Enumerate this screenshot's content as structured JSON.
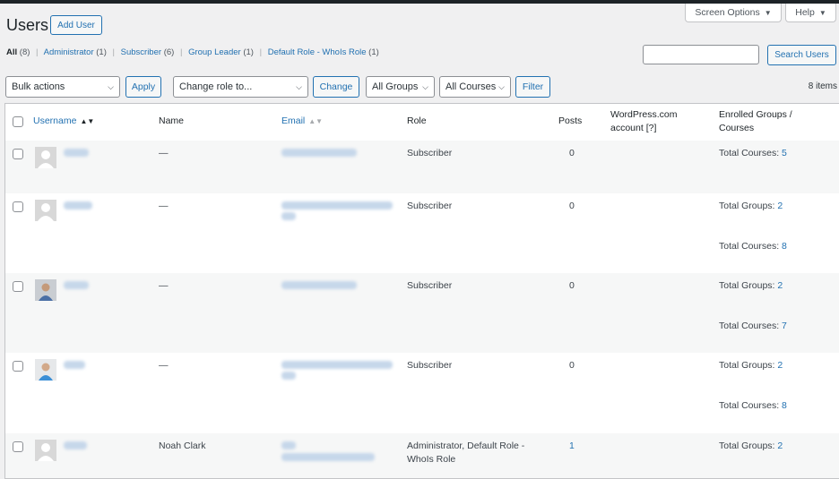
{
  "header": {
    "title": "Users",
    "add_user": "Add User",
    "screen_options": "Screen Options",
    "help": "Help"
  },
  "filters": {
    "all": "All",
    "all_count": "(8)",
    "administrator": "Administrator",
    "administrator_count": "(1)",
    "subscriber": "Subscriber",
    "subscriber_count": "(6)",
    "group_leader": "Group Leader",
    "group_leader_count": "(1)",
    "default_role": "Default Role - WhoIs Role",
    "default_role_count": "(1)"
  },
  "search": {
    "button": "Search Users",
    "value": ""
  },
  "toolbar": {
    "bulk_actions": "Bulk actions",
    "apply": "Apply",
    "change_role": "Change role to...",
    "change": "Change",
    "all_groups": "All Groups",
    "all_courses": "All Courses",
    "filter": "Filter",
    "items_count": "8 items"
  },
  "table": {
    "columns": {
      "username": "Username",
      "name": "Name",
      "email": "Email",
      "role": "Role",
      "posts": "Posts",
      "wpcom_line1": "WordPress.com",
      "wpcom_line2": "account [?]",
      "enrolled_line1": "Enrolled Groups /",
      "enrolled_line2": "Courses"
    },
    "rows": [
      {
        "name": "—",
        "role": "Subscriber",
        "role_line2": "",
        "posts": "0",
        "groups_label": "",
        "groups_value": "",
        "courses_label": "Total Courses:",
        "courses_value": "5"
      },
      {
        "name": "—",
        "role": "Subscriber",
        "role_line2": "",
        "posts": "0",
        "groups_label": "Total Groups:",
        "groups_value": "2",
        "courses_label": "Total Courses:",
        "courses_value": "8"
      },
      {
        "name": "—",
        "role": "Subscriber",
        "role_line2": "",
        "posts": "0",
        "groups_label": "Total Groups:",
        "groups_value": "2",
        "courses_label": "Total Courses:",
        "courses_value": "7"
      },
      {
        "name": "—",
        "role": "Subscriber",
        "role_line2": "",
        "posts": "0",
        "groups_label": "Total Groups:",
        "groups_value": "2",
        "courses_label": "Total Courses:",
        "courses_value": "8"
      },
      {
        "name": "Noah Clark",
        "role": "Administrator, Default Role -",
        "role_line2": "WhoIs Role",
        "posts": "1",
        "groups_label": "Total Groups:",
        "groups_value": "2",
        "courses_label": "",
        "courses_value": ""
      }
    ]
  },
  "colors": {
    "accent": "#2271b1",
    "text": "#1d2327",
    "background": "#f0f0f1",
    "row_alt": "#f6f7f7"
  },
  "icons": [
    "sort-active-icon",
    "sort-icon",
    "chevron-down-icon",
    "caret-down-icon",
    "default-avatar-icon",
    "photo-avatar-icon"
  ]
}
